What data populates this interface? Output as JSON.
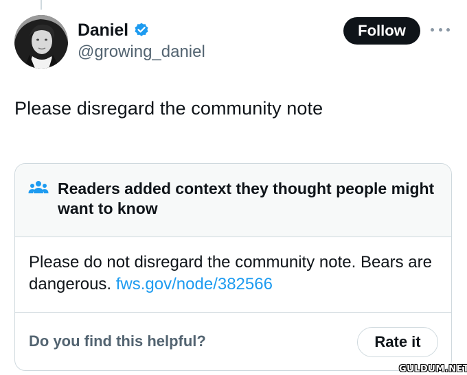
{
  "tweet": {
    "author": {
      "display_name": "Daniel",
      "handle": "@growing_daniel",
      "verified": true
    },
    "follow_label": "Follow",
    "more_icon": "more-horizontal-icon",
    "text": "Please disregard the community note"
  },
  "community_note": {
    "header_icon": "readers-group-icon",
    "title": "Readers added context they thought people might want to know",
    "body_text": "Please do not disregard the community note. Bears are dangerous.",
    "link_text": "fws.gov/node/382566",
    "helpful_question": "Do you find this helpful?",
    "rate_label": "Rate it"
  },
  "watermark": "GULDUM.NET",
  "colors": {
    "accent_blue": "#1d9bf0",
    "text_primary": "#0f1419",
    "text_secondary": "#536471",
    "border": "#cfd9de",
    "note_header_bg": "#f7f9f9"
  }
}
